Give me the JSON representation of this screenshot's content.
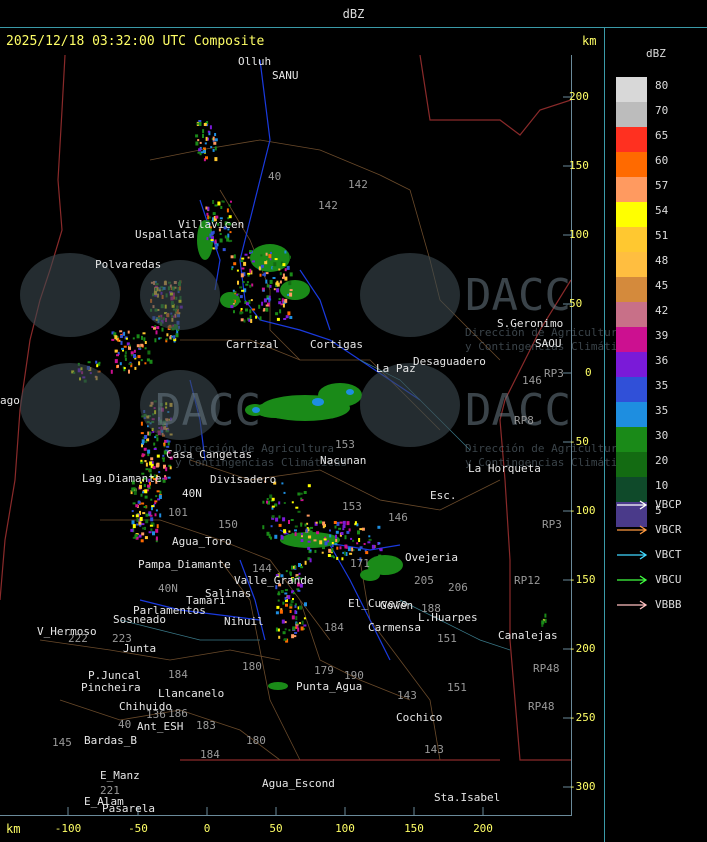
{
  "header": {
    "title": "dBZ"
  },
  "map": {
    "timestamp": "2025/12/18 03:32:00 UTC Composite",
    "units_top": "km",
    "units_bottom": "km",
    "y_ticks": [
      "200",
      "150",
      "100",
      "50",
      "0",
      "-50",
      "-100",
      "-150",
      "-200",
      "-250",
      "-300"
    ],
    "x_ticks": [
      "-100",
      "-50",
      "0",
      "50",
      "100",
      "150",
      "200"
    ],
    "places": [
      "Olluh",
      "SANU",
      "Uspallata",
      "Villavicen",
      "Polvaredas",
      "Carrizal",
      "Cortigas",
      "S.Geronimo",
      "SAOU",
      "Desaguadero",
      "La Paz",
      "Nacunan",
      "La Horqueta",
      "Casa Cangetas",
      "Lag.Diamante",
      "Divisadero",
      "Esc.",
      "Agua_Toro",
      "Pampa_Diamante",
      "Valle_Grande",
      "Salinas",
      "Nihuil",
      "Parlamentos",
      "Sosneado",
      "V_Hermoso",
      "Junta",
      "P.Juncal",
      "Pincheira",
      "Llancanelo",
      "Chihuido",
      "Ant_ESH",
      "Bardas_B",
      "E_Manz",
      "E_Alam",
      "Pasarela",
      "Agua_Escond",
      "Punta_Agua",
      "Cochico",
      "Sta.Isabel",
      "Carmensa",
      "L.Huarpes",
      "Canalejas",
      "Ovejeria",
      "El_Cuvero",
      "Gowen",
      "Tamari",
      "40N",
      "ago"
    ],
    "routes": [
      "142",
      "142",
      "40",
      "153",
      "153",
      "146",
      "150",
      "144",
      "171",
      "205",
      "206",
      "188",
      "184",
      "179",
      "190",
      "143",
      "151",
      "180",
      "186",
      "183",
      "136",
      "145",
      "221",
      "184",
      "40N",
      "101",
      "222",
      "223",
      "RP3",
      "RP8",
      "RP12",
      "RP48",
      "RP48",
      "RP3",
      "146",
      "151",
      "143",
      "40",
      "180",
      "184"
    ],
    "watermark": {
      "brand": "DACC",
      "line1": "Dirección de Agricultura",
      "line2": "y Contingencias Climáticas"
    }
  },
  "legend": {
    "levels": [
      {
        "label": "80",
        "color": "#d8d8d8"
      },
      {
        "label": "70",
        "color": "#bcbcbc"
      },
      {
        "label": "65",
        "color": "#ff3020"
      },
      {
        "label": "60",
        "color": "#ff6a00"
      },
      {
        "label": "57",
        "color": "#ff9a60"
      },
      {
        "label": "54",
        "color": "#ffff00"
      },
      {
        "label": "51",
        "color": "#ffc830"
      },
      {
        "label": "48",
        "color": "#ffbe40"
      },
      {
        "label": "45",
        "color": "#d48a3c"
      },
      {
        "label": "42",
        "color": "#c87088"
      },
      {
        "label": "39",
        "color": "#cc1090"
      },
      {
        "label": "36",
        "color": "#7a1ad8"
      },
      {
        "label": "35",
        "color": "#3050d8"
      },
      {
        "label": "35b",
        "color": "#1e8ee0"
      },
      {
        "label": "30",
        "color": "#1a8a18"
      },
      {
        "label": "20",
        "color": "#136b12"
      },
      {
        "label": "10",
        "color": "#0f4a2a"
      },
      {
        "label": "5",
        "color": "#4a3a8a"
      }
    ],
    "radars": [
      {
        "label": "VBCP",
        "color": "#ffffff"
      },
      {
        "label": "VBCR",
        "color": "#ff9a40"
      },
      {
        "label": "VBCT",
        "color": "#40d8ff"
      },
      {
        "label": "VBCU",
        "color": "#40ff40"
      },
      {
        "label": "VBBB",
        "color": "#ffc0c0"
      }
    ]
  }
}
